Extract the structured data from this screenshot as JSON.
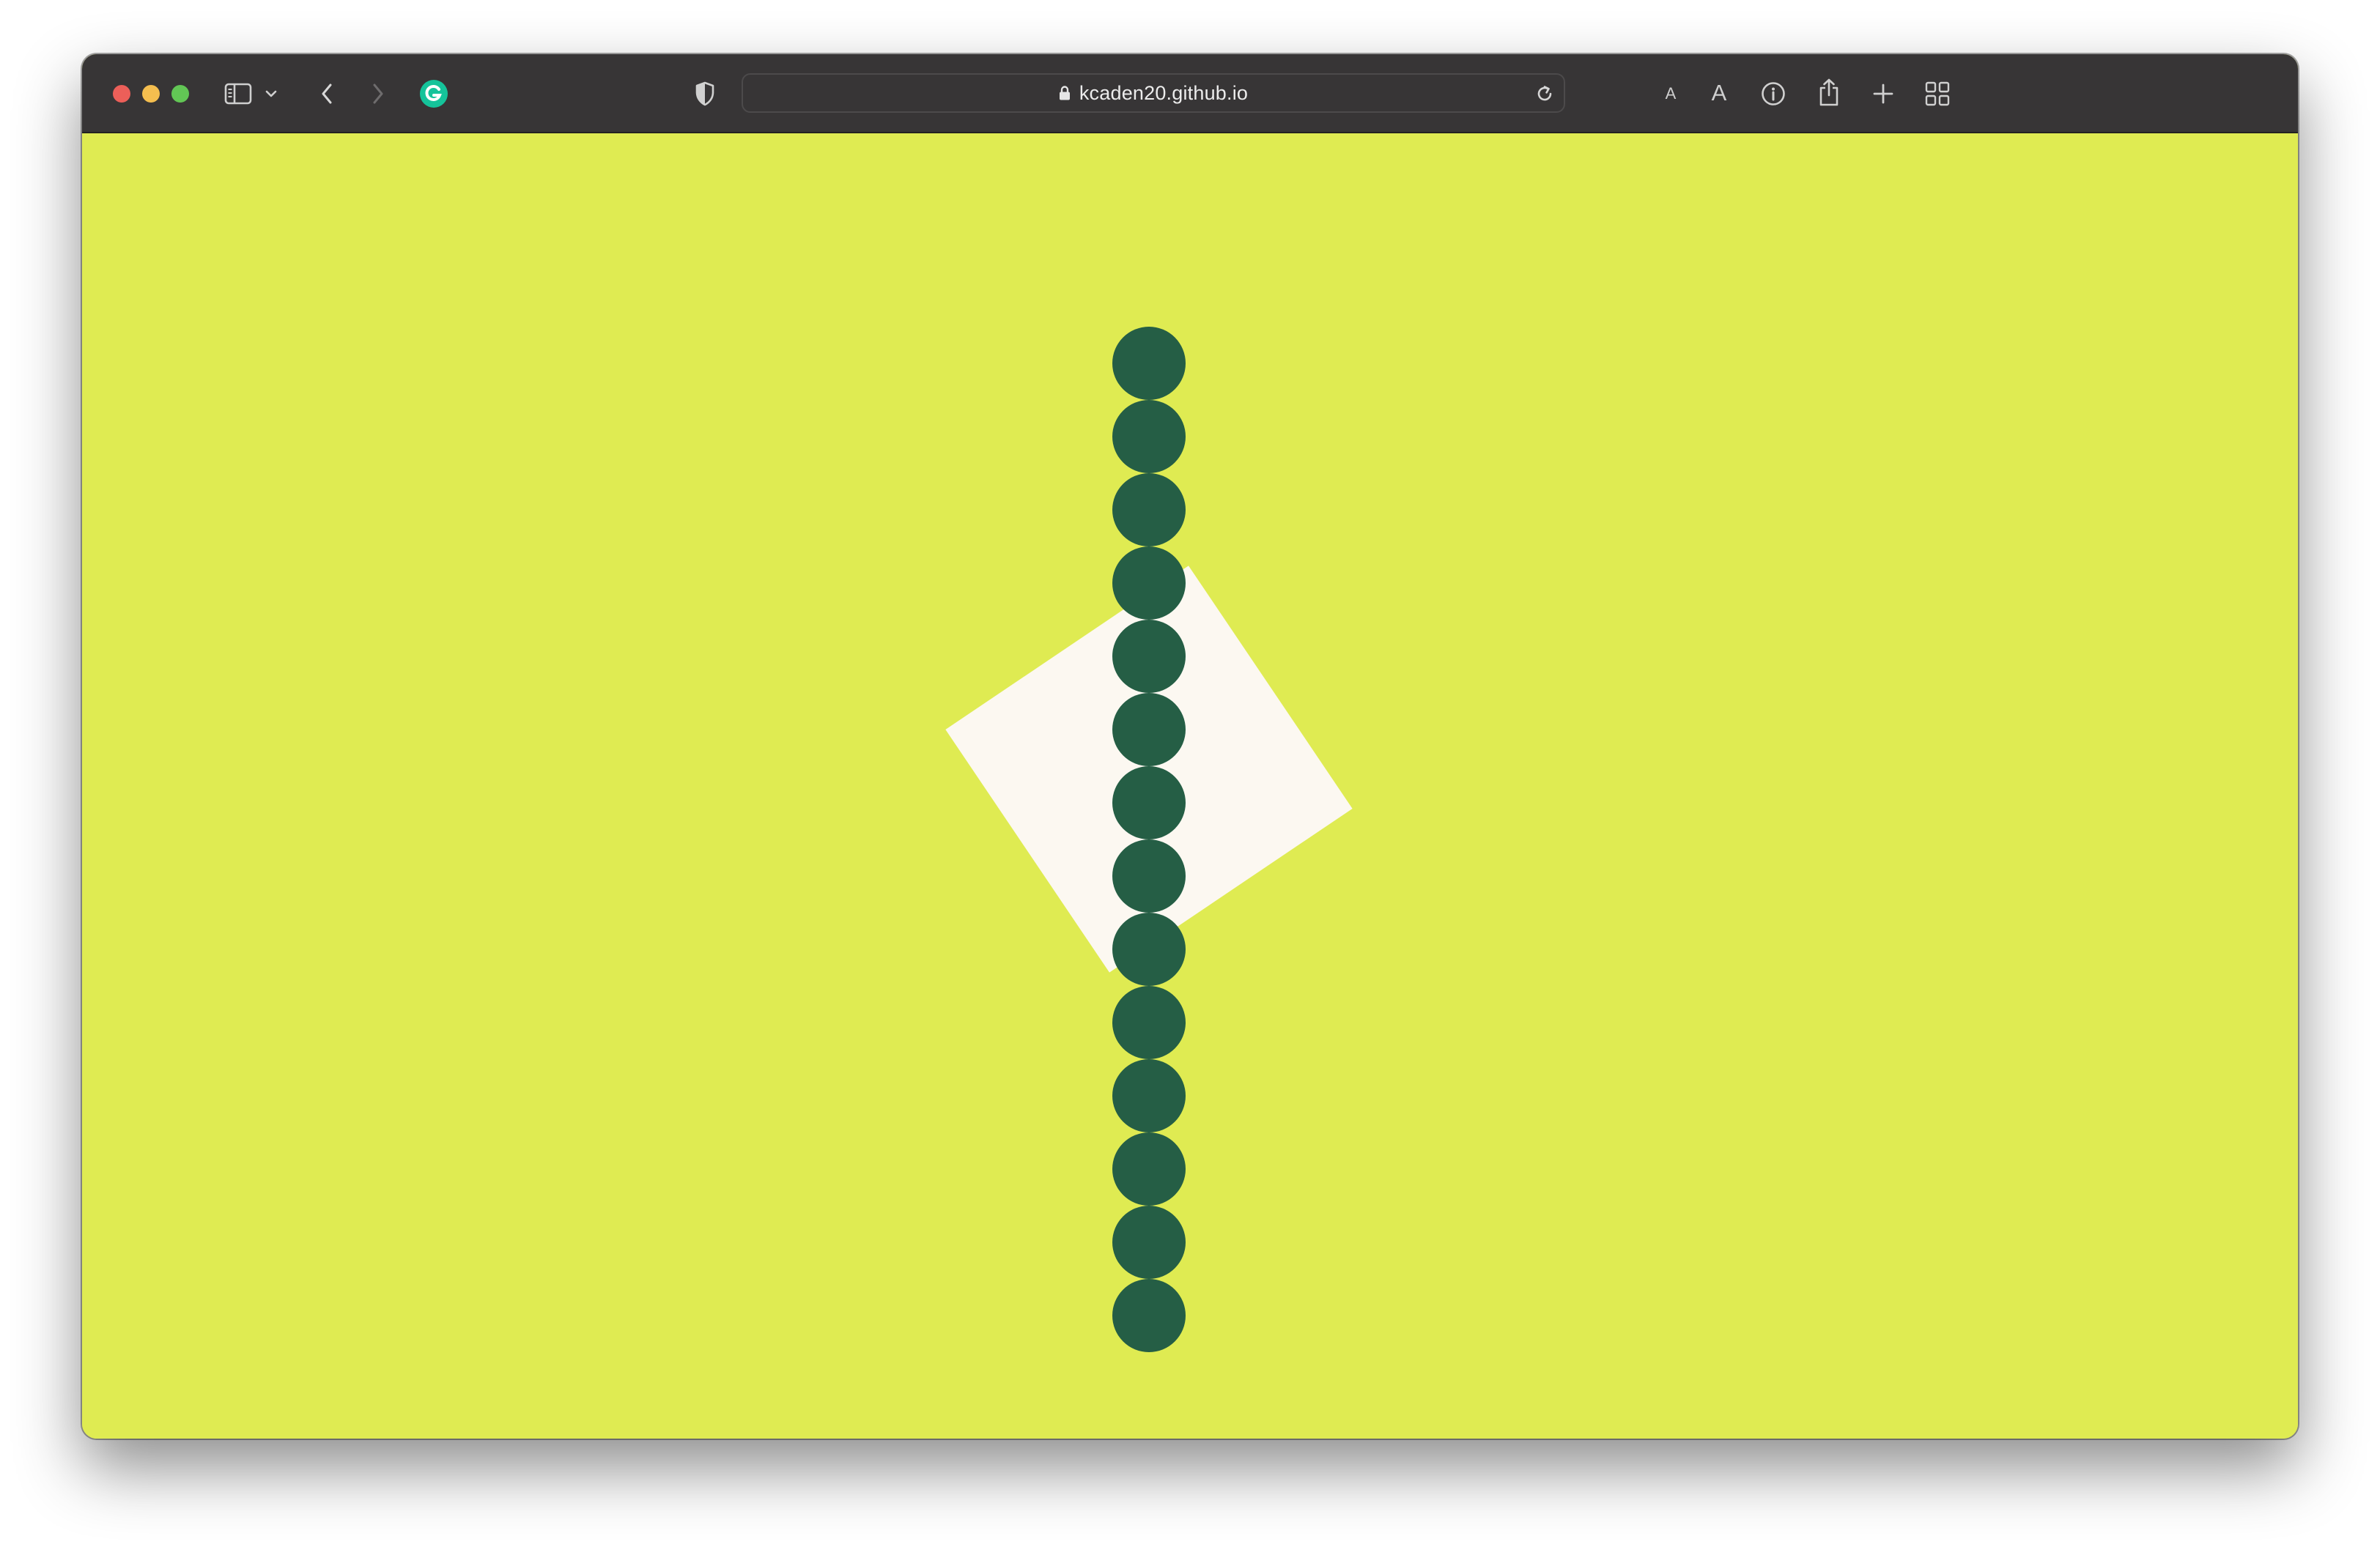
{
  "browser": {
    "url": "kcaden20.github.io",
    "traffic_lights": {
      "close": "#ec5f59",
      "minimize": "#f4be4f",
      "maximize": "#62c655"
    },
    "icons": {
      "sidebar": "sidebar-icon",
      "sidebar_menu": "chevron-down-icon",
      "back": "chevron-left-icon",
      "forward": "chevron-right-icon",
      "extension": "grammarly-icon",
      "privacy": "shield-icon",
      "lock": "lock-icon",
      "reload": "reload-icon",
      "text_smaller": "A",
      "text_larger": "A",
      "info": "info-icon",
      "share": "share-icon",
      "new_tab": "plus-icon",
      "tab_overview": "grid-icon"
    }
  },
  "page": {
    "background_color": "#dfeb52",
    "square_color": "#fcf8f1",
    "dot_color": "#255e45",
    "dot_count": 14
  }
}
